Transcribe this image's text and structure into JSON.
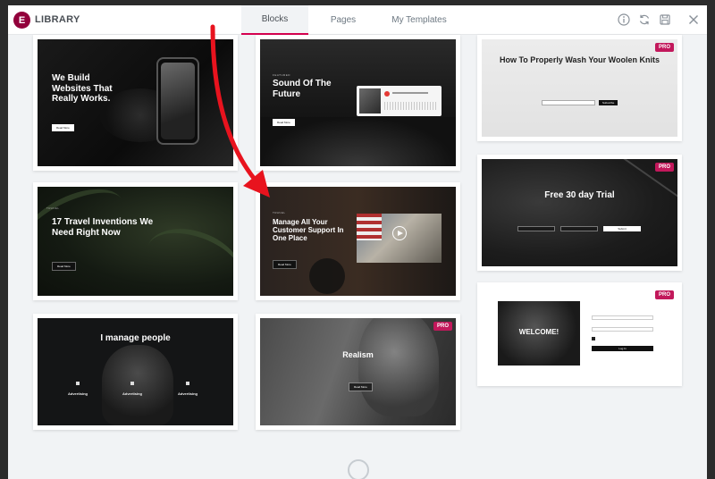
{
  "header": {
    "logo_letter": "E",
    "title": "LIBRARY",
    "tabs": [
      {
        "label": "Blocks",
        "active": true
      },
      {
        "label": "Pages",
        "active": false
      },
      {
        "label": "My Templates",
        "active": false
      }
    ],
    "icons": [
      "info-icon",
      "sync-icon",
      "save-icon",
      "close-icon"
    ]
  },
  "colors": {
    "accent": "#d5004f",
    "logo": "#92003b",
    "pro_badge": "#c2185b",
    "arrow": "#e8131e"
  },
  "pro_label": "PRO",
  "templates": [
    {
      "headline": "We Build Websites That Really Works.",
      "button": "Read More"
    },
    {
      "eyebrow": "FEATURED",
      "headline": "Sound Of The Future",
      "button": "Read More"
    },
    {
      "headline": "How To Properly Wash Your Woolen Knits",
      "button": "Subscribe",
      "pro": true
    },
    {
      "eyebrow": "TRAVEL",
      "headline": "17 Travel Inventions We Need Right Now",
      "button": "Read More"
    },
    {
      "eyebrow": "TRAVEL",
      "headline": "Manage All Your Customer Support In One Place",
      "button": "Read More"
    },
    {
      "headline": "Free 30 day Trial",
      "button": "Submit",
      "pro": true
    },
    {
      "headline": "I manage people",
      "features": [
        "Advertising",
        "Advertising",
        "Advertising"
      ]
    },
    {
      "headline": "Realism",
      "button": "Read More",
      "pro": true
    },
    {
      "headline": "WELCOME!",
      "button": "Log In",
      "pro": true
    }
  ]
}
